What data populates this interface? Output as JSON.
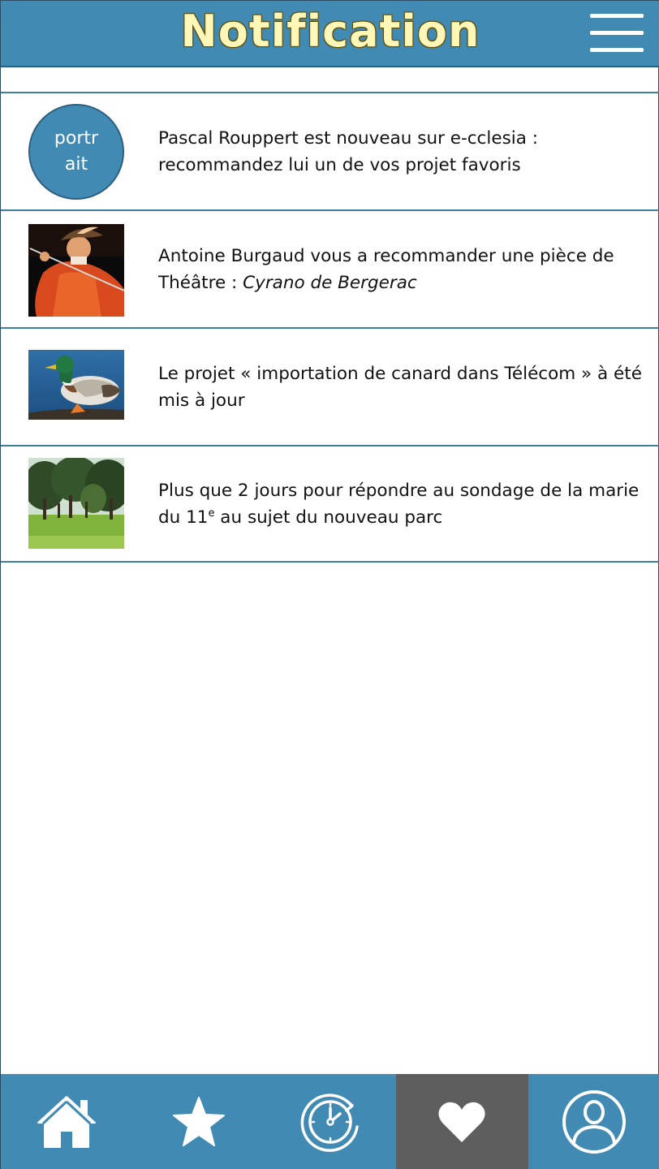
{
  "header": {
    "title": "Notification",
    "menu_icon": "hamburger-menu-icon"
  },
  "colors": {
    "header_bg": "#418ab3",
    "title_text": "#fff7b8",
    "divider": "#3f7ea3",
    "active_tab_bg": "#5e5e5e"
  },
  "notifications": [
    {
      "thumbnail": "avatar-placeholder",
      "avatar_label": "portr ait",
      "text": "Pascal Rouppert est nouveau sur e-cclesia : recommandez lui un de vos projet favoris"
    },
    {
      "thumbnail": "cyrano-theatre-photo",
      "text_prefix": "Antoine Burgaud vous a recommander une pièce de Théâtre : ",
      "text_title": "Cyrano de Bergerac"
    },
    {
      "thumbnail": "duck-photo",
      "text": "Le projet « importation de canard dans Télécom » à été mis à jour"
    },
    {
      "thumbnail": "park-photo",
      "text_prefix": "Plus que 2 jours pour répondre au sondage de la marie du 11",
      "text_sup": "e",
      "text_suffix": " au sujet du nouveau parc"
    }
  ],
  "tabs": [
    {
      "icon": "home-icon",
      "active": false
    },
    {
      "icon": "star-icon",
      "active": false
    },
    {
      "icon": "history-clock-icon",
      "active": false
    },
    {
      "icon": "heart-icon",
      "active": true
    },
    {
      "icon": "profile-icon",
      "active": false
    }
  ]
}
